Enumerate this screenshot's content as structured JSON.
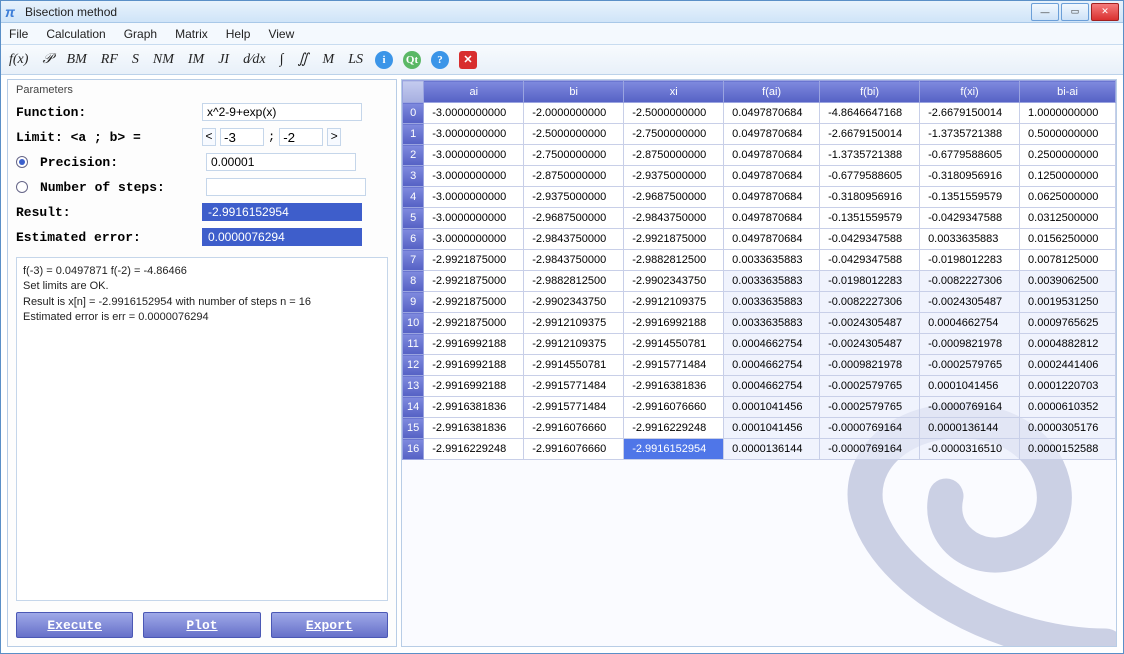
{
  "window": {
    "title": "Bisection method"
  },
  "menu": [
    "File",
    "Calculation",
    "Graph",
    "Matrix",
    "Help",
    "View"
  ],
  "toolbar": [
    "f(x)",
    "𝒫",
    "BM",
    "RF",
    "S",
    "NM",
    "IM",
    "JI",
    "d⁄dx",
    "∫",
    "∬",
    "M",
    "LS"
  ],
  "params": {
    "section_title": "Parameters",
    "function_label": "Function:",
    "function_value": "x^2-9+exp(x)",
    "limit_label": "Limit: <a ; b> =",
    "limit_a": "-3",
    "limit_b": "-2",
    "precision_label": "Precision:",
    "precision_value": "0.00001",
    "steps_label": "Number of steps:",
    "result_label": "Result:",
    "result_value": "-2.9916152954",
    "error_label": "Estimated error:",
    "error_value": "0.0000076294"
  },
  "log": {
    "line1": "f(-3) = 0.0497871    f(-2) = -4.86466",
    "line2": "Set limits are OK.",
    "line3": "Result is x[n] = -2.9916152954     with number of steps n = 16",
    "line4": "Estimated error is err = 0.0000076294"
  },
  "buttons": {
    "execute": "Execute",
    "plot": "Plot",
    "export": "Export"
  },
  "table": {
    "headers": [
      "ai",
      "bi",
      "xi",
      "f(ai)",
      "f(bi)",
      "f(xi)",
      "bi-ai"
    ],
    "selected": {
      "row": 16,
      "col": 2
    },
    "rows": [
      [
        "-3.0000000000",
        "-2.0000000000",
        "-2.5000000000",
        "0.0497870684",
        "-4.8646647168",
        "-2.6679150014",
        "1.0000000000"
      ],
      [
        "-3.0000000000",
        "-2.5000000000",
        "-2.7500000000",
        "0.0497870684",
        "-2.6679150014",
        "-1.3735721388",
        "0.5000000000"
      ],
      [
        "-3.0000000000",
        "-2.7500000000",
        "-2.8750000000",
        "0.0497870684",
        "-1.3735721388",
        "-0.6779588605",
        "0.2500000000"
      ],
      [
        "-3.0000000000",
        "-2.8750000000",
        "-2.9375000000",
        "0.0497870684",
        "-0.6779588605",
        "-0.3180956916",
        "0.1250000000"
      ],
      [
        "-3.0000000000",
        "-2.9375000000",
        "-2.9687500000",
        "0.0497870684",
        "-0.3180956916",
        "-0.1351559579",
        "0.0625000000"
      ],
      [
        "-3.0000000000",
        "-2.9687500000",
        "-2.9843750000",
        "0.0497870684",
        "-0.1351559579",
        "-0.0429347588",
        "0.0312500000"
      ],
      [
        "-3.0000000000",
        "-2.9843750000",
        "-2.9921875000",
        "0.0497870684",
        "-0.0429347588",
        "0.0033635883",
        "0.0156250000"
      ],
      [
        "-2.9921875000",
        "-2.9843750000",
        "-2.9882812500",
        "0.0033635883",
        "-0.0429347588",
        "-0.0198012283",
        "0.0078125000"
      ],
      [
        "-2.9921875000",
        "-2.9882812500",
        "-2.9902343750",
        "0.0033635883",
        "-0.0198012283",
        "-0.0082227306",
        "0.0039062500"
      ],
      [
        "-2.9921875000",
        "-2.9902343750",
        "-2.9912109375",
        "0.0033635883",
        "-0.0082227306",
        "-0.0024305487",
        "0.0019531250"
      ],
      [
        "-2.9921875000",
        "-2.9912109375",
        "-2.9916992188",
        "0.0033635883",
        "-0.0024305487",
        "0.0004662754",
        "0.0009765625"
      ],
      [
        "-2.9916992188",
        "-2.9912109375",
        "-2.9914550781",
        "0.0004662754",
        "-0.0024305487",
        "-0.0009821978",
        "0.0004882812"
      ],
      [
        "-2.9916992188",
        "-2.9914550781",
        "-2.9915771484",
        "0.0004662754",
        "-0.0009821978",
        "-0.0002579765",
        "0.0002441406"
      ],
      [
        "-2.9916992188",
        "-2.9915771484",
        "-2.9916381836",
        "0.0004662754",
        "-0.0002579765",
        "0.0001041456",
        "0.0001220703"
      ],
      [
        "-2.9916381836",
        "-2.9915771484",
        "-2.9916076660",
        "0.0001041456",
        "-0.0002579765",
        "-0.0000769164",
        "0.0000610352"
      ],
      [
        "-2.9916381836",
        "-2.9916076660",
        "-2.9916229248",
        "0.0001041456",
        "-0.0000769164",
        "0.0000136144",
        "0.0000305176"
      ],
      [
        "-2.9916229248",
        "-2.9916076660",
        "-2.9916152954",
        "0.0000136144",
        "-0.0000769164",
        "-0.0000316510",
        "0.0000152588"
      ]
    ]
  }
}
